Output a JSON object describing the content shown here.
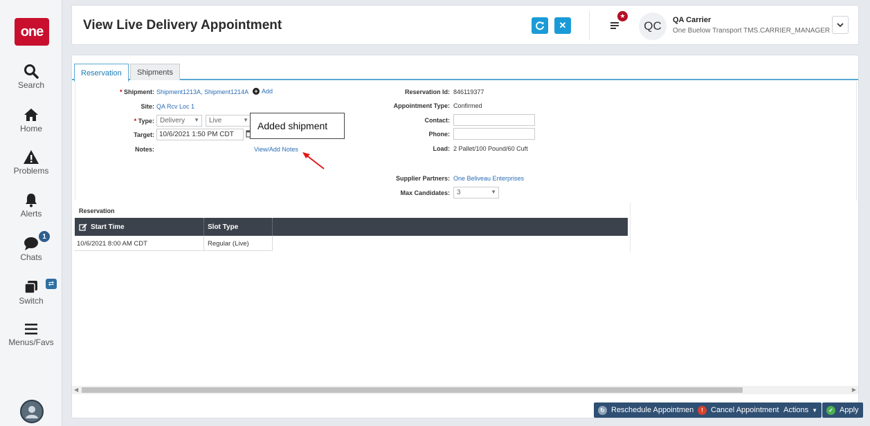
{
  "app": {
    "logo": "one"
  },
  "sidebar": {
    "items": [
      {
        "label": "Search",
        "icon": "search-icon"
      },
      {
        "label": "Home",
        "icon": "home-icon"
      },
      {
        "label": "Problems",
        "icon": "warning-icon"
      },
      {
        "label": "Alerts",
        "icon": "bell-icon"
      },
      {
        "label": "Chats",
        "icon": "chat-icon",
        "badge": "1"
      },
      {
        "label": "Switch",
        "icon": "switch-icon"
      },
      {
        "label": "Menus/Favs",
        "icon": "hamburger-icon"
      }
    ]
  },
  "header": {
    "title": "View Live Delivery Appointment",
    "user_initials": "QC",
    "user_name": "QA Carrier",
    "user_org": "One Buelow Transport TMS.CARRIER_MANAGER"
  },
  "tabs": [
    {
      "label": "Reservation",
      "active": true
    },
    {
      "label": "Shipments",
      "active": false
    }
  ],
  "form": {
    "shipment_label": "Shipment:",
    "shipment_value": "Shipment1213A, Shipment1214A",
    "add_label": "Add",
    "site_label": "Site:",
    "site_value": "QA Rcv Loc 1",
    "type_label": "Type:",
    "type_value": "Delivery",
    "type2_value": "Live",
    "target_label": "Target:",
    "target_value": "10/6/2021 1:50 PM CDT",
    "notes_label": "Notes:",
    "notes_link": "View/Add Notes",
    "reservation_id_label": "Reservation Id:",
    "reservation_id_value": "846119377",
    "appointment_type_label": "Appointment Type:",
    "appointment_type_value": "Confirmed",
    "contact_label": "Contact:",
    "contact_value": "",
    "phone_label": "Phone:",
    "phone_value": "",
    "load_label": "Load:",
    "load_value": "2 Pallet/100 Pound/60 Cuft",
    "supplier_label": "Supplier Partners:",
    "supplier_value": "One Beliveau Enterprises",
    "max_candidates_label": "Max Candidates:",
    "max_candidates_value": "3"
  },
  "callout": {
    "text": "Added shipment"
  },
  "grid": {
    "title": "Reservation",
    "columns": [
      "Start Time",
      "Slot Type"
    ],
    "rows": [
      [
        "10/6/2021 8:00 AM CDT",
        "Regular (Live)"
      ]
    ]
  },
  "footer": {
    "reschedule": "Reschedule Appointment",
    "cancel": "Cancel Appointment",
    "actions": "Actions",
    "apply": "Apply"
  },
  "colors": {
    "brand_red": "#c8102e",
    "accent_blue": "#1a9bd7",
    "footer_button": "#2f4f73",
    "grid_header": "#3b424b"
  }
}
